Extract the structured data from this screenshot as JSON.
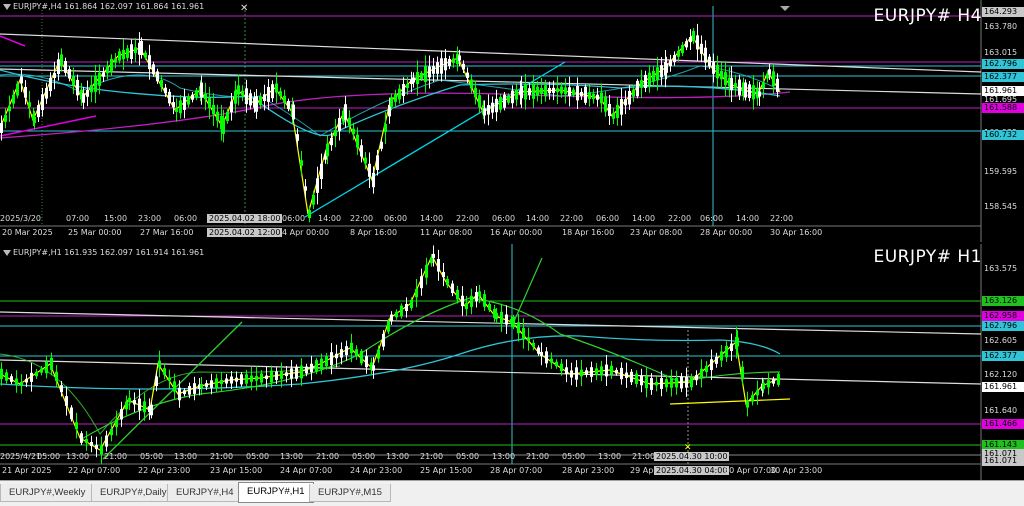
{
  "upper": {
    "header": "EURJPY#,H4  161.864 162.097 161.864 161.961",
    "title": "EURJPY# H4",
    "y_ticks": [
      "163.780",
      "163.015",
      "161.695",
      "160.935",
      "159.595",
      "158.545"
    ],
    "price_labels": [
      {
        "text": "164.293",
        "bg": "#c8c8c8",
        "fg": "#000000"
      },
      {
        "text": "162.796",
        "bg": "#2fc4d6",
        "fg": "#000000"
      },
      {
        "text": "162.377",
        "bg": "#2fc4d6",
        "fg": "#000000"
      },
      {
        "text": "161.961",
        "bg": "#ffffff",
        "fg": "#000000"
      },
      {
        "text": "161.588",
        "bg": "#e000e0",
        "fg": "#000000"
      },
      {
        "text": "160.732",
        "bg": "#2fc4d6",
        "fg": "#000000"
      }
    ],
    "x_labels_top": [
      "2025/3/20",
      "07:00",
      "15:00",
      "23:00",
      "06:00",
      "14:00",
      "06:00",
      "14:00",
      "22:00",
      "06:00",
      "14:00",
      "22:00",
      "06:00",
      "14:00",
      "22:00",
      "06:00",
      "14:00",
      "22:00",
      "06:00",
      "14:00",
      "22:00"
    ],
    "x_labels_bottom": [
      "20 Mar 2025",
      "25 Mar 00:00",
      "27 Mar 16:00",
      "4 Apr 00:00",
      "8 Apr 16:00",
      "11 Apr 08:00",
      "16 Apr 00:00",
      "18 Apr 16:00",
      "23 Apr 08:00",
      "28 Apr 00:00",
      "30 Apr 16:00"
    ],
    "crosshair_time_1": "2025.04.02 18:00",
    "crosshair_time_2": "2025.04.02 12:00"
  },
  "lower": {
    "header": "EURJPY#,H1  161.935 162.097 161.914 161.961",
    "title": "EURJPY# H1",
    "y_ticks": [
      "163.575",
      "162.605",
      "162.120",
      "161.640"
    ],
    "price_labels": [
      {
        "text": "163.126",
        "bg": "#20c020",
        "fg": "#000000"
      },
      {
        "text": "162.958",
        "bg": "#e000e0",
        "fg": "#000000"
      },
      {
        "text": "162.796",
        "bg": "#2fc4d6",
        "fg": "#000000"
      },
      {
        "text": "162.377",
        "bg": "#2fc4d6",
        "fg": "#000000"
      },
      {
        "text": "161.961",
        "bg": "#ffffff",
        "fg": "#000000"
      },
      {
        "text": "161.466",
        "bg": "#e000e0",
        "fg": "#000000"
      },
      {
        "text": "161.143",
        "bg": "#20c020",
        "fg": "#000000"
      },
      {
        "text": "161.071",
        "bg": "#c8c8c8",
        "fg": "#000000"
      },
      {
        "text": "161.071",
        "bg": "#c8c8c8",
        "fg": "#000000"
      }
    ],
    "x_labels": [
      "21 Apr 2025",
      "22 Apr 07:00",
      "22 Apr 23:00",
      "23 Apr 15:00",
      "24 Apr 07:00",
      "24 Apr 23:00",
      "25 Apr 15:00",
      "28 Apr 07:00",
      "28 Apr 23:00",
      "29 Apr 15:00",
      "30 Apr 07:00",
      "30 Apr 23:00"
    ],
    "x_labels_top": [
      "2025/4/21",
      "05:00",
      "13:00",
      "21:00",
      "05:00",
      "13:00",
      "21:00",
      "05:00",
      "13:00",
      "21:00",
      "05:00",
      "13:00",
      "21:00",
      "05:00",
      "13:00",
      "21:00",
      "05:00",
      "13:00",
      "21:00",
      "05:00"
    ],
    "crosshair_time_1": "2025.04.30 10:00",
    "crosshair_time_2": "2025.04.30 04:00"
  },
  "tabs": [
    {
      "label": "EURJPY#,Weekly",
      "active": false
    },
    {
      "label": "EURJPY#,Daily",
      "active": false
    },
    {
      "label": "EURJPY#,H4",
      "active": false
    },
    {
      "label": "EURJPY#,H1",
      "active": true
    },
    {
      "label": "EURJPY#,M15",
      "active": false
    }
  ],
  "colors": {
    "bull": "#00ff00",
    "bear": "#ffffff",
    "zigzag": "#ffff00",
    "ma_cyan": "#2fc4d6",
    "ma_magenta": "#c020c0",
    "trend": "#00d8e8",
    "green_ma": "#20c020"
  }
}
